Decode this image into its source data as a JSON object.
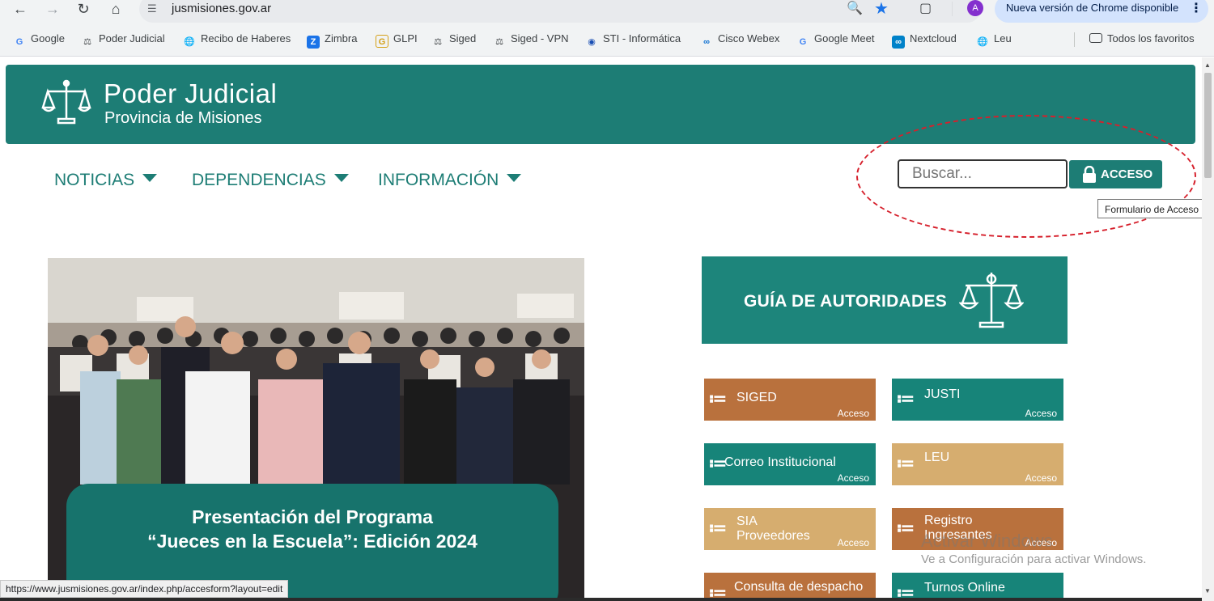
{
  "browser": {
    "url": "jusmisiones.gov.ar",
    "update_label": "Nueva versión de Chrome disponible",
    "avatar_letter": "A",
    "status_url": "https://www.jusmisiones.gov.ar/index.php/accesform?layout=edit"
  },
  "bookmarks": [
    {
      "label": "Google",
      "icon": "google-icon",
      "color": "#4285f4"
    },
    {
      "label": "Poder Judicial",
      "icon": "scales-icon",
      "color": "#3c4043"
    },
    {
      "label": "Recibo de Haberes",
      "icon": "globe-icon",
      "color": "#3c4043"
    },
    {
      "label": "Zimbra",
      "icon": "zimbra-icon",
      "color": "#1a73e8"
    },
    {
      "label": "GLPI",
      "icon": "glpi-icon",
      "color": "#d4a017"
    },
    {
      "label": "Siged",
      "icon": "scales-icon",
      "color": "#3c4043"
    },
    {
      "label": "Siged - VPN",
      "icon": "scales-icon",
      "color": "#3c4043"
    },
    {
      "label": "STI - Informática",
      "icon": "sti-icon",
      "color": "#1a4fb4"
    },
    {
      "label": "Cisco Webex",
      "icon": "webex-icon",
      "color": "#0a6ed1"
    },
    {
      "label": "Google Meet",
      "icon": "google-icon",
      "color": "#4285f4"
    },
    {
      "label": "Nextcloud",
      "icon": "nextcloud-icon",
      "color": "#0082c9"
    },
    {
      "label": "Leu",
      "icon": "globe-icon",
      "color": "#3c4043"
    }
  ],
  "all_bookmarks_label": "Todos los favoritos",
  "site": {
    "title": "Poder Judicial",
    "subtitle": "Provincia de Misiones",
    "brand_color": "#1d7d75"
  },
  "menu": [
    {
      "label": "NOTICIAS"
    },
    {
      "label": "DEPENDENCIAS"
    },
    {
      "label": "INFORMACIÓN"
    }
  ],
  "search": {
    "placeholder": "Buscar..."
  },
  "acceso": {
    "label": "ACCESO",
    "tooltip": "Formulario de Acceso"
  },
  "hero": {
    "line1": "Presentación del Programa",
    "line2": "“Jueces en la Escuela”: Edición 2024"
  },
  "guia": {
    "label": "GUÍA DE AUTORIDADES"
  },
  "tiles": [
    {
      "line1": "SIGED",
      "line2": "",
      "access": "Acceso",
      "color": "#b9713d"
    },
    {
      "line1": "JUSTI",
      "line2": "",
      "access": "Acceso",
      "color": "#178479"
    },
    {
      "line1": "Correo Institucional",
      "line2": "",
      "access": "Acceso",
      "color": "#178479"
    },
    {
      "line1": "LEU",
      "line2": "",
      "access": "Acceso",
      "color": "#d6ad6f"
    },
    {
      "line1": "SIA",
      "line2": "Proveedores",
      "access": "Acceso",
      "color": "#d6ad6f"
    },
    {
      "line1": "Registro",
      "line2": "Ingresantes",
      "access": "Acceso",
      "color": "#b9713d"
    },
    {
      "line1": "Consulta de despacho",
      "line2": "",
      "access": "",
      "color": "#b9713d"
    },
    {
      "line1": "Turnos Online",
      "line2": "",
      "access": "",
      "color": "#178479"
    }
  ],
  "windows_watermark": {
    "line1": "Activar Windows",
    "line2": "Ve a Configuración para activar Windows."
  }
}
